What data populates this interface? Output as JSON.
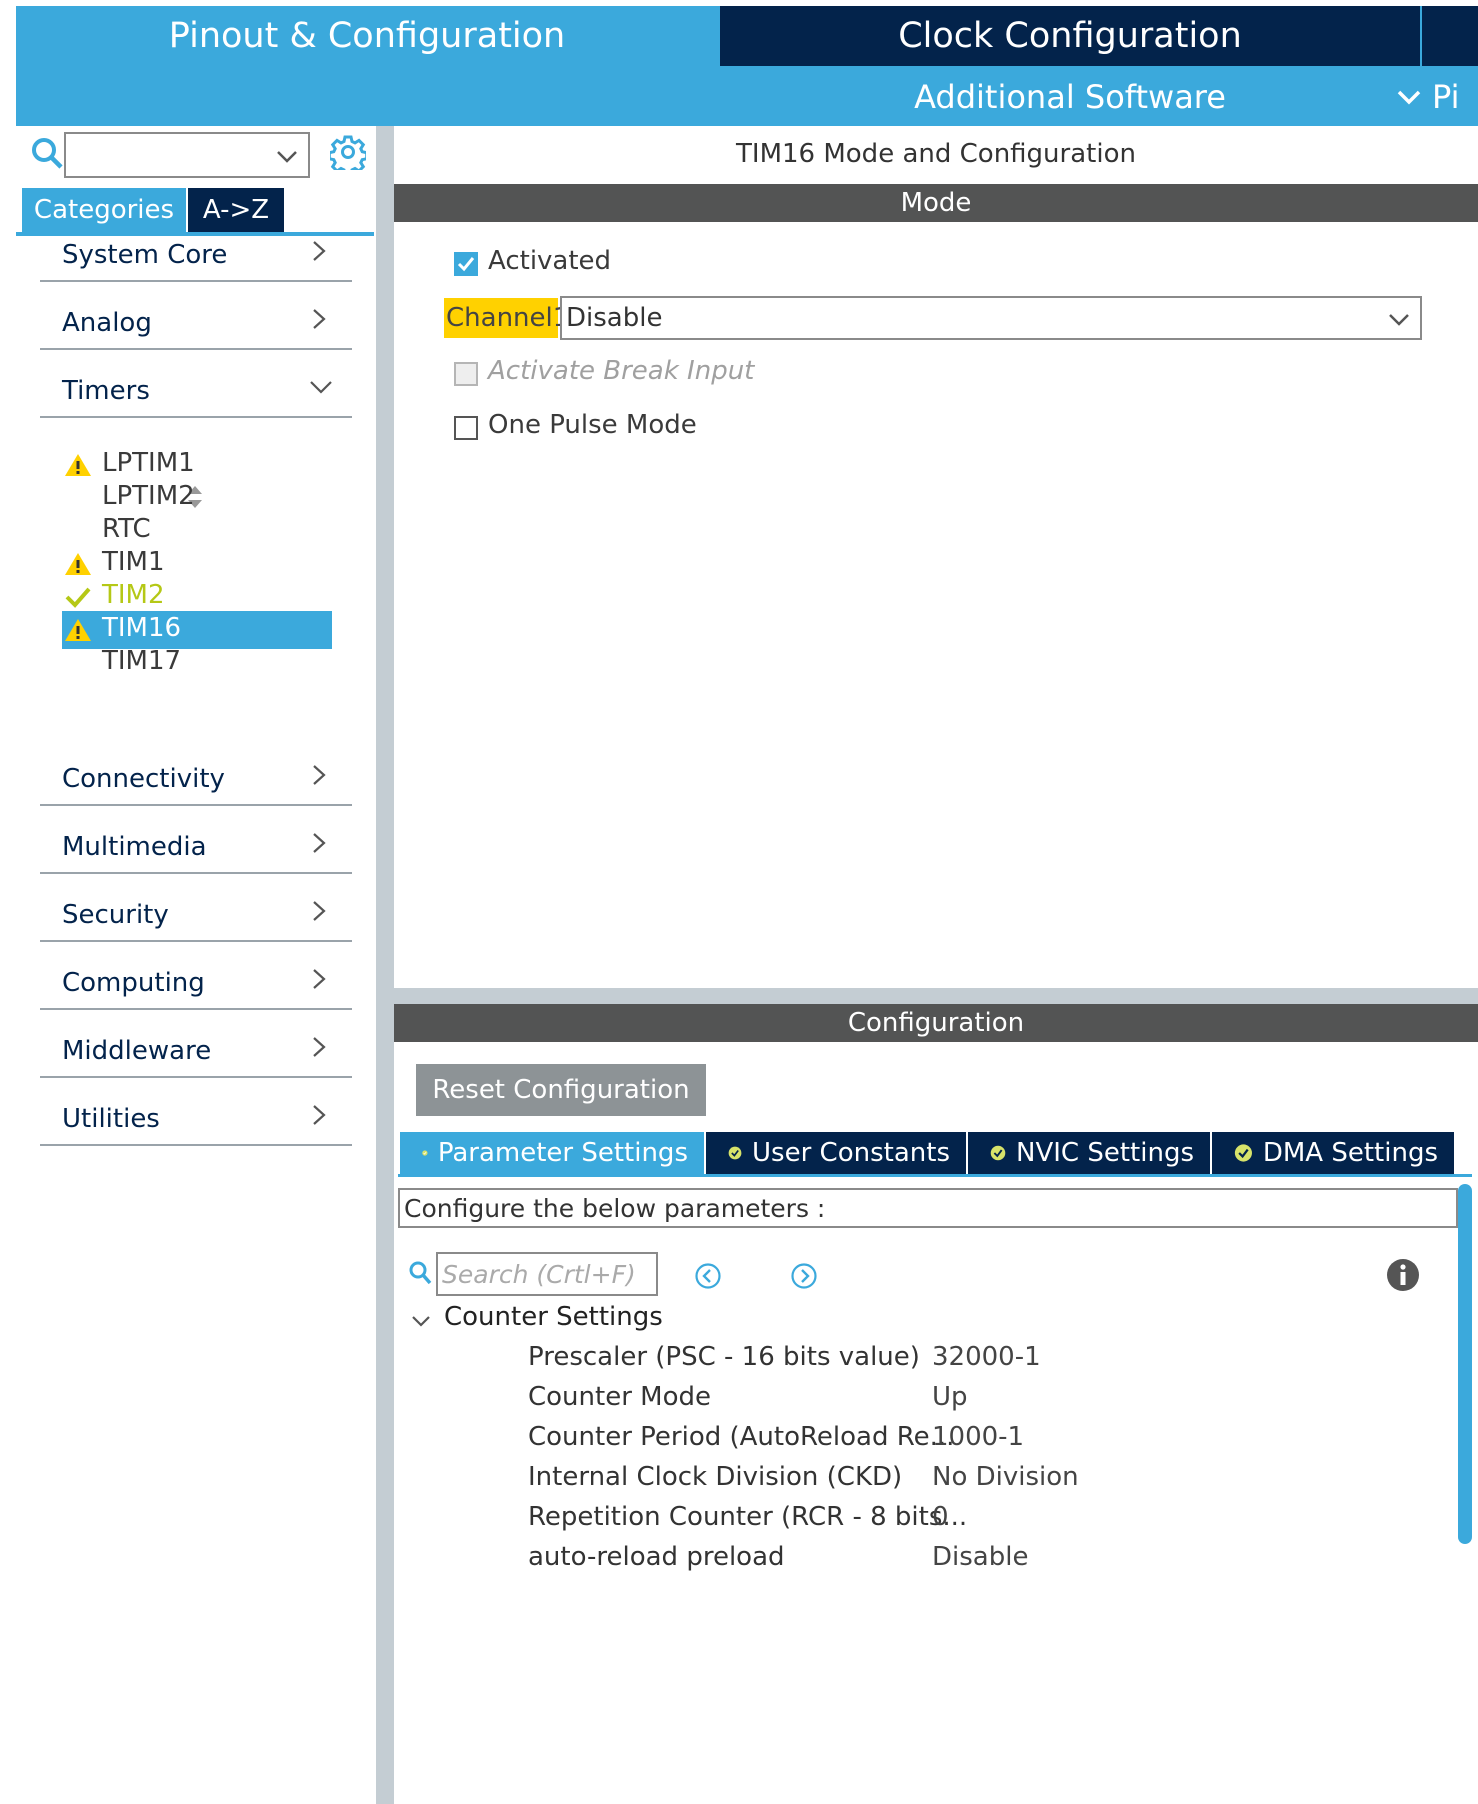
{
  "header": {
    "tab_pinout": "Pinout & Configuration",
    "tab_clock": "Clock Configuration",
    "tab_additional": "Additional Software",
    "tab_pin_partial": "Pi"
  },
  "sidebar": {
    "tabs": {
      "categories": "Categories",
      "az": "A->Z"
    },
    "categories": [
      {
        "label": "System Core"
      },
      {
        "label": "Analog"
      },
      {
        "label": "Timers"
      },
      {
        "label": "Connectivity"
      },
      {
        "label": "Multimedia"
      },
      {
        "label": "Security"
      },
      {
        "label": "Computing"
      },
      {
        "label": "Middleware"
      },
      {
        "label": "Utilities"
      }
    ],
    "timers": [
      {
        "label": "LPTIM1",
        "status": "warning"
      },
      {
        "label": "LPTIM2",
        "status": "none"
      },
      {
        "label": "RTC",
        "status": "none"
      },
      {
        "label": "TIM1",
        "status": "warning"
      },
      {
        "label": "TIM2",
        "status": "ok"
      },
      {
        "label": "TIM16",
        "status": "warning-selected"
      },
      {
        "label": "TIM17",
        "status": "none"
      }
    ]
  },
  "main": {
    "title": "TIM16 Mode and Configuration",
    "mode_bar": "Mode",
    "mode": {
      "activated_label": "Activated",
      "activated": true,
      "channel_label": "Channel1",
      "channel_value": "Disable",
      "break_label": "Activate Break Input",
      "one_pulse_label": "One Pulse Mode"
    },
    "config_bar": "Configuration",
    "reset_label": "Reset Configuration",
    "tabs": [
      "Parameter Settings",
      "User Constants",
      "NVIC Settings",
      "DMA Settings"
    ],
    "description": "Configure the below parameters :",
    "search_placeholder": "Search (Crtl+F)",
    "group_label": "Counter Settings",
    "params": [
      {
        "name": "Prescaler (PSC - 16 bits value)",
        "value": "32000-1"
      },
      {
        "name": "Counter Mode",
        "value": "Up"
      },
      {
        "name": "Counter Period (AutoReload Re...",
        "value": "1000-1"
      },
      {
        "name": "Internal Clock Division (CKD)",
        "value": "No Division"
      },
      {
        "name": "Repetition Counter (RCR - 8 bits...",
        "value": "0"
      },
      {
        "name": "auto-reload preload",
        "value": "Disable"
      }
    ]
  },
  "colors": {
    "accent": "#3ba9dc",
    "navy": "#03234b",
    "bar": "#535454",
    "warning": "#ffd100",
    "ok": "#b5c816"
  }
}
